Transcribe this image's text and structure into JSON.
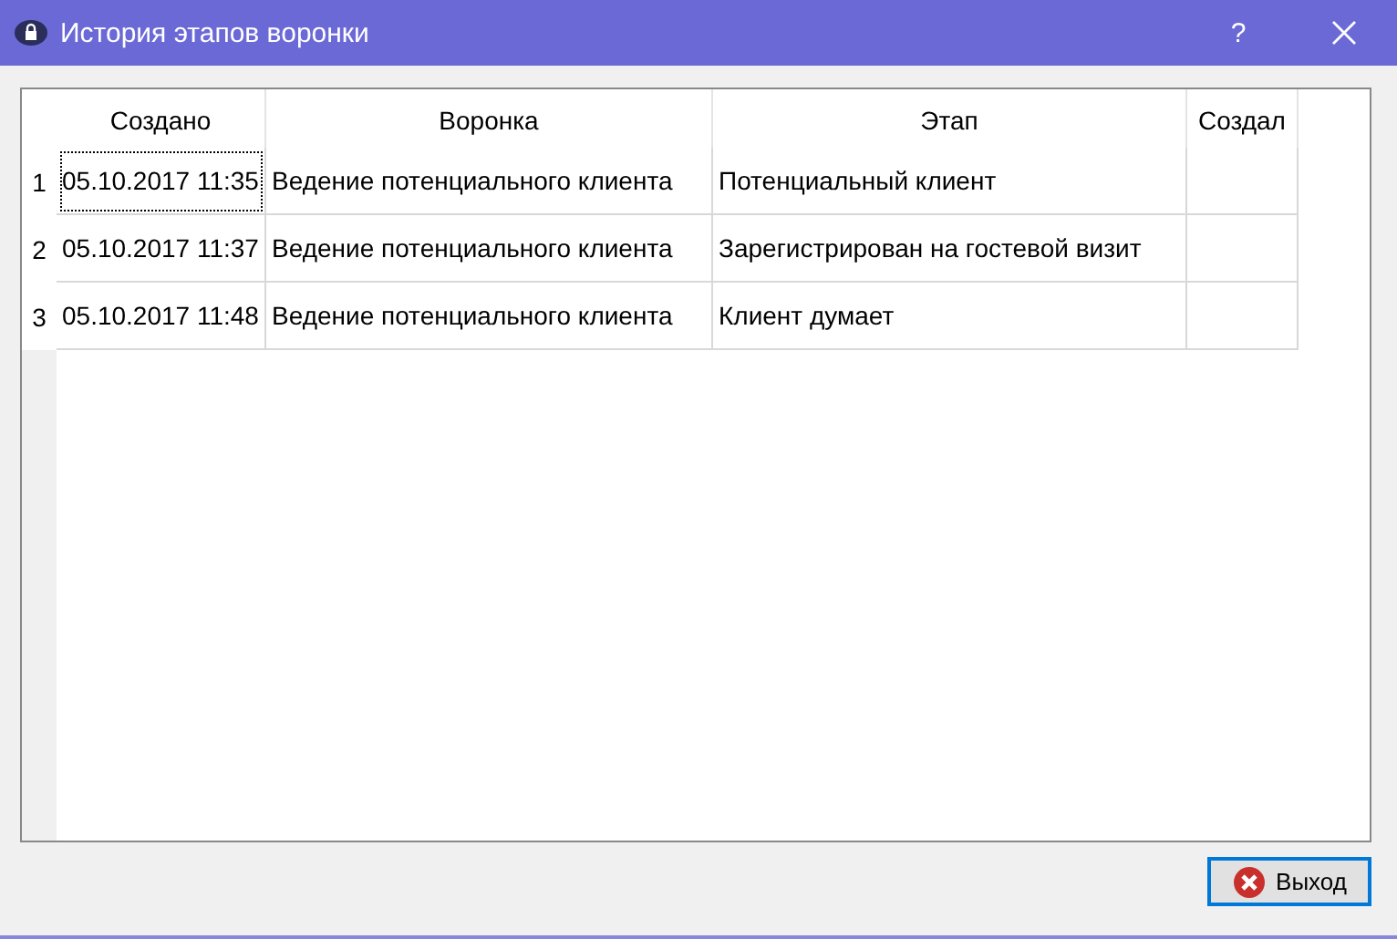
{
  "window": {
    "title": "История этапов воронки",
    "help": "?"
  },
  "table": {
    "columns": [
      "Создано",
      "Воронка",
      "Этап",
      "Создал"
    ],
    "rows": [
      {
        "number": "1",
        "cells": [
          {
            "text": "05.10.2017 11:35",
            "focused": true
          },
          {
            "text": "Ведение потенциального клиента",
            "focused": false
          },
          {
            "text": "Потенциальный клиент",
            "focused": false
          },
          {
            "text": "",
            "focused": false
          }
        ]
      },
      {
        "number": "2",
        "cells": [
          {
            "text": "05.10.2017 11:37",
            "focused": false
          },
          {
            "text": "Ведение потенциального клиента",
            "focused": false
          },
          {
            "text": "Зарегистрирован на гостевой визит",
            "focused": false
          },
          {
            "text": "",
            "focused": false
          }
        ]
      },
      {
        "number": "3",
        "cells": [
          {
            "text": "05.10.2017 11:48",
            "focused": false
          },
          {
            "text": "Ведение потенциального клиента",
            "focused": false
          },
          {
            "text": "Клиент думает",
            "focused": false
          },
          {
            "text": "",
            "focused": false
          }
        ]
      }
    ]
  },
  "buttons": [
    {
      "label": "Выход",
      "kind": "exit",
      "default": true
    }
  ]
}
